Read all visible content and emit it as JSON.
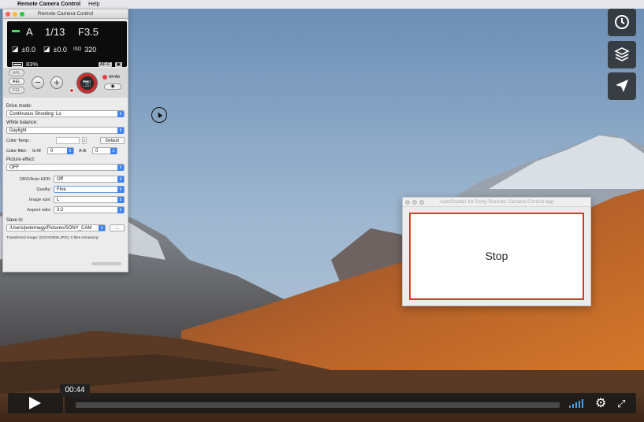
{
  "menubar": {
    "apple": "",
    "app_name": "Remote Camera Control",
    "help": "Help"
  },
  "rc_window": {
    "title": "Remote Camera Control",
    "lcd": {
      "mode_icon": "▬",
      "mode": "A",
      "shutter": "1/13",
      "aperture": "F3.5",
      "ev_icon": "◪",
      "ev1": "±0.0",
      "ev2_icon": "◪",
      "ev2": "±0.0",
      "iso_label": "ISO",
      "iso": "320",
      "battery": "83%",
      "focus_mode": "AF-C",
      "metering_icon": "▣"
    },
    "controls": {
      "afl": "AFL",
      "ael": "AEL",
      "fel": "FEL",
      "af_ae": "AF/AE"
    },
    "drive_mode_label": "Drive mode:",
    "drive_mode": "Continuous Shooting: Lo",
    "wb_label": "White balance:",
    "wb": "Daylight",
    "color_temp_label": "Color Temp.:",
    "default_btn": "Default",
    "color_filter_label": "Color filter:",
    "gm_label": "G-M",
    "gm": "0",
    "ab_label": "A-B",
    "ab": "0",
    "picture_effect_label": "Picture effect:",
    "picture_effect": "OFF",
    "dro_label": "DRO/Auto HDR:",
    "dro": "Off",
    "quality_label": "Quality:",
    "quality": "Fine",
    "image_size_label": "Image size:",
    "image_size": "L",
    "aspect_label": "Aspect ratio:",
    "aspect": "3:2",
    "save_in_label": "Save in:",
    "save_path": "/Users/peternagy/Pictures/SONY_CAM",
    "browse_btn": "...",
    "transferred": "Transferred image: (DSC00008.JPG); 0 files remaining"
  },
  "autoshutter": {
    "title": "AutoShutter for Sony Remote Camera Control app",
    "stop": "Stop"
  },
  "player": {
    "time": "00:44",
    "progress": 0.0,
    "side_icons": [
      "clock-icon",
      "layers-icon",
      "send-icon"
    ]
  },
  "colors": {
    "accent": "#3b82f6",
    "stop_border": "#d83a2a",
    "volume": "#4ba3e6"
  }
}
